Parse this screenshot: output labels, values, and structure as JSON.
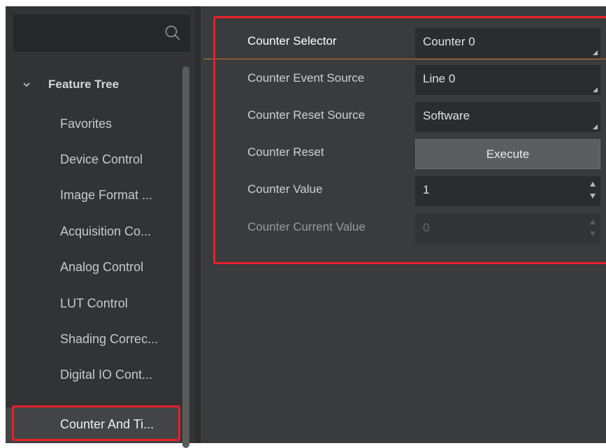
{
  "search": {
    "value": "",
    "icon": "search-icon"
  },
  "feature_tree": {
    "header": "Feature Tree",
    "items": [
      {
        "label": "Favorites"
      },
      {
        "label": "Device Control"
      },
      {
        "label": "Image Format ..."
      },
      {
        "label": "Acquisition Co..."
      },
      {
        "label": "Analog Control"
      },
      {
        "label": "LUT Control"
      },
      {
        "label": "Shading Correc..."
      },
      {
        "label": "Digital IO Cont..."
      },
      {
        "label": "Counter And Ti...",
        "selected": true
      }
    ]
  },
  "properties": [
    {
      "label": "Counter Selector",
      "value": "Counter 0",
      "type": "dropdown"
    },
    {
      "label": "Counter Event Source",
      "value": "Line 0",
      "type": "dropdown"
    },
    {
      "label": "Counter Reset Source",
      "value": "Software",
      "type": "dropdown"
    },
    {
      "label": "Counter Reset",
      "value": "Execute",
      "type": "button"
    },
    {
      "label": "Counter Value",
      "value": "1",
      "type": "spinbox"
    },
    {
      "label": "Counter Current Value",
      "value": "0",
      "type": "spinbox",
      "disabled": true
    }
  ],
  "colors": {
    "panel_bg": "#3a3b3d",
    "sidebar_bg": "#323335",
    "highlight": "#e8202a",
    "accent_line": "#c9782e"
  }
}
